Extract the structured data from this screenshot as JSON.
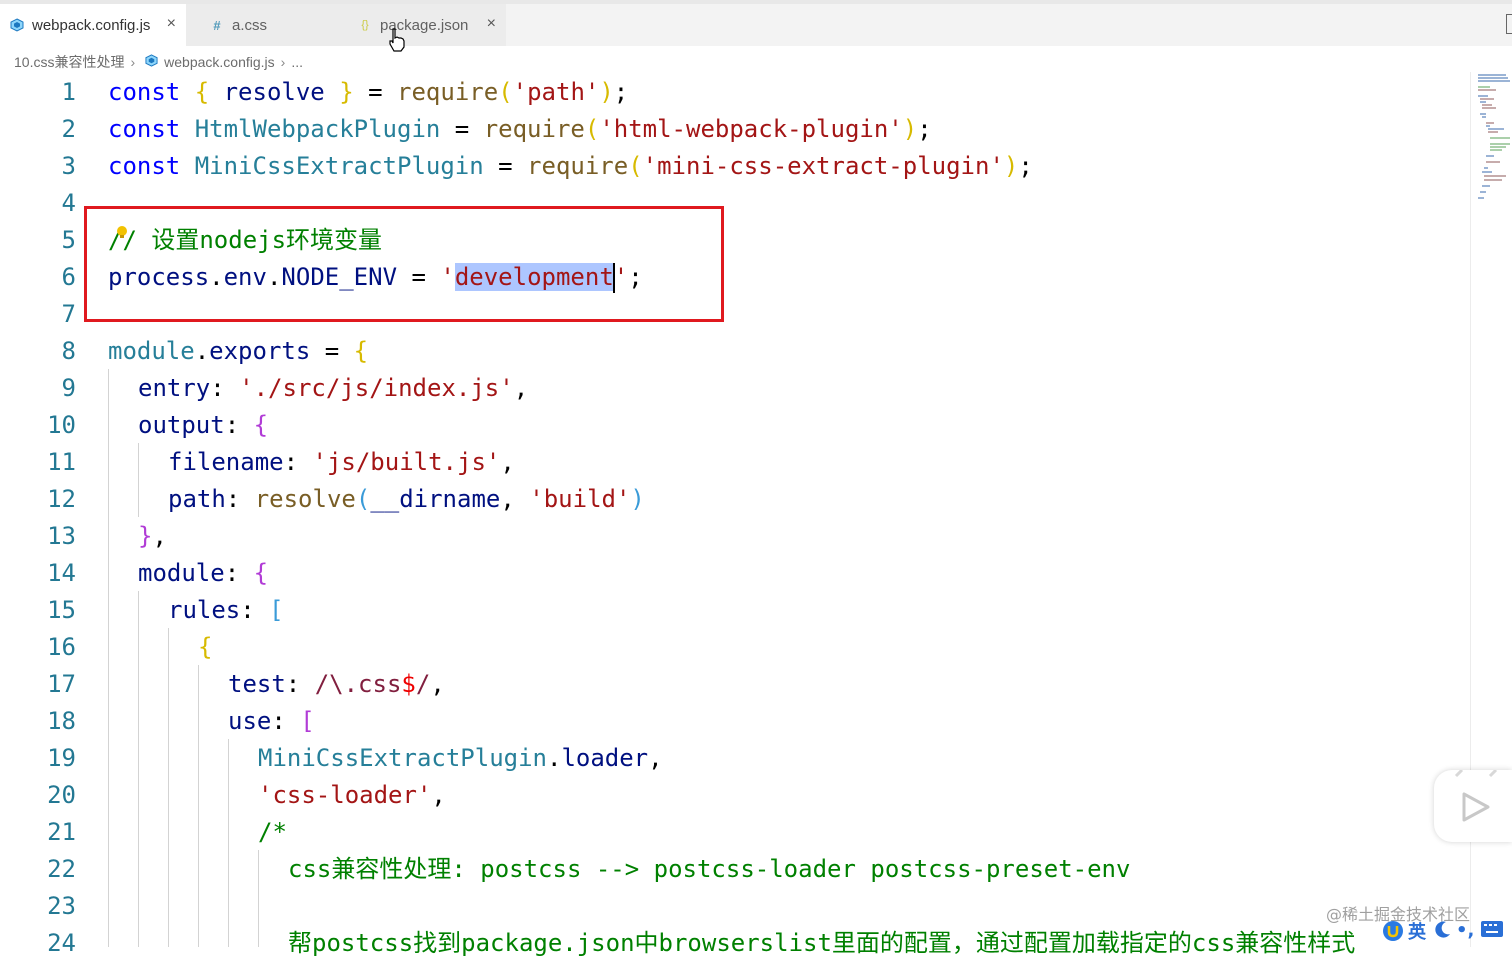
{
  "tabs": [
    {
      "label": "webpack.config.js",
      "icon": "webpack-icon",
      "close": "×"
    },
    {
      "label": "a.css",
      "icon": "hash-css-icon",
      "icon_glyph": "#"
    },
    {
      "label": "package.json",
      "icon": "json-braces-icon",
      "icon_glyph": "{}",
      "close": "×"
    }
  ],
  "breadcrumb": {
    "folder": "10.css兼容性处理",
    "file": "webpack.config.js",
    "tail": "...",
    "sep": "›"
  },
  "line_numbers": [
    "1",
    "2",
    "3",
    "4",
    "5",
    "6",
    "7",
    "8",
    "9",
    "10",
    "11",
    "12",
    "13",
    "14",
    "15",
    "16",
    "17",
    "18",
    "19",
    "20",
    "21",
    "22",
    "23",
    "24"
  ],
  "code": {
    "l1": {
      "kw": "const",
      "lb": "{",
      "name": "resolve",
      "rb": "}",
      "eq": "=",
      "fn": "require",
      "lp": "(",
      "str": "'path'",
      "rp": ")",
      "semi": ";"
    },
    "l2": {
      "kw": "const",
      "name": "HtmlWebpackPlugin",
      "eq": "=",
      "fn": "require",
      "lp": "(",
      "str": "'html-webpack-plugin'",
      "rp": ")",
      "semi": ";"
    },
    "l3": {
      "kw": "const",
      "name": "MiniCssExtractPlugin",
      "eq": "=",
      "fn": "require",
      "lp": "(",
      "str": "'mini-css-extract-plugin'",
      "rp": ")",
      "semi": ";"
    },
    "l5": {
      "comment": "// 设置nodejs环境变量"
    },
    "l6": {
      "obj": "process",
      "dot1": ".",
      "prop1": "env",
      "dot2": ".",
      "prop2": "NODE_ENV",
      "eq": "=",
      "q1": "'",
      "value": "development",
      "q2": "'",
      "semi": ";"
    },
    "l8": {
      "obj": "module",
      "dot": ".",
      "prop": "exports",
      "eq": "=",
      "lb": "{"
    },
    "l9": {
      "key": "entry",
      "colon": ":",
      "str": "'./src/js/index.js'",
      "comma": ","
    },
    "l10": {
      "key": "output",
      "colon": ":",
      "lb": "{"
    },
    "l11": {
      "key": "filename",
      "colon": ":",
      "str": "'js/built.js'",
      "comma": ","
    },
    "l12": {
      "key": "path",
      "colon": ":",
      "fn": "resolve",
      "lp": "(",
      "arg": "__dirname",
      "comma": ",",
      "str": "'build'",
      "rp": ")"
    },
    "l13": {
      "rb": "}",
      "comma": ","
    },
    "l14": {
      "key": "module",
      "colon": ":",
      "lb": "{"
    },
    "l15": {
      "key": "rules",
      "colon": ":",
      "lb": "["
    },
    "l16": {
      "lb": "{"
    },
    "l17": {
      "key": "test",
      "colon": ":",
      "re_a": "/\\.css",
      "re_b": "$",
      "re_c": "/",
      "comma": ","
    },
    "l18": {
      "key": "use",
      "colon": ":",
      "lb": "["
    },
    "l19": {
      "obj": "MiniCssExtractPlugin",
      "dot": ".",
      "prop": "loader",
      "comma": ","
    },
    "l20": {
      "str": "'css-loader'",
      "comma": ","
    },
    "l21": {
      "comment": "/*"
    },
    "l22": {
      "comment": "css兼容性处理: postcss --> postcss-loader postcss-preset-env"
    },
    "l24": {
      "comment": "帮postcss找到package.json中browserslist里面的配置，通过配置加载指定的css兼容性样式"
    }
  },
  "watermark": "@稀土掘金技术社区",
  "ime": {
    "label": "英"
  },
  "colors": {
    "keyword": "#0000ff",
    "variable": "#001080",
    "class": "#267f99",
    "function": "#795e26",
    "string": "#a31515",
    "comment": "#008000",
    "selection": "#adc6ff",
    "highlight_box": "#e0191f",
    "line_number": "#237893"
  }
}
